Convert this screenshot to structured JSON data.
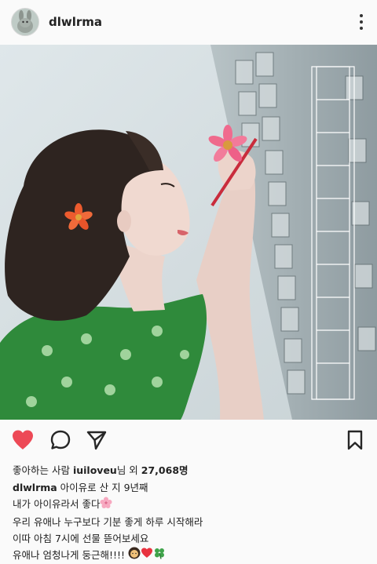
{
  "post": {
    "username": "dlwlrma",
    "menu_icon": "more-vertical-icon",
    "likes": {
      "prefix": "좋아하는 사람 ",
      "user": "iuiloveu",
      "middle": "님 외 ",
      "count": "27,068",
      "suffix": "명"
    },
    "caption": {
      "username": "dlwlrma",
      "line1": " 아이유로 산 지 9년째",
      "line2": "내가 아이유라서 좋다",
      "line3": "우리 유애나 누구보다 기분 좋게 하루 시작해라",
      "line4": "이따 아침 7시에 선물 뜯어보세요",
      "line5": "유애나 엄청나게 둥근해!!!!"
    },
    "icons": [
      "heart-icon",
      "comment-icon",
      "share-icon",
      "bookmark-icon"
    ]
  },
  "colors": {
    "like_red": "#ed4956",
    "text": "#262626",
    "background": "#fafafa"
  }
}
